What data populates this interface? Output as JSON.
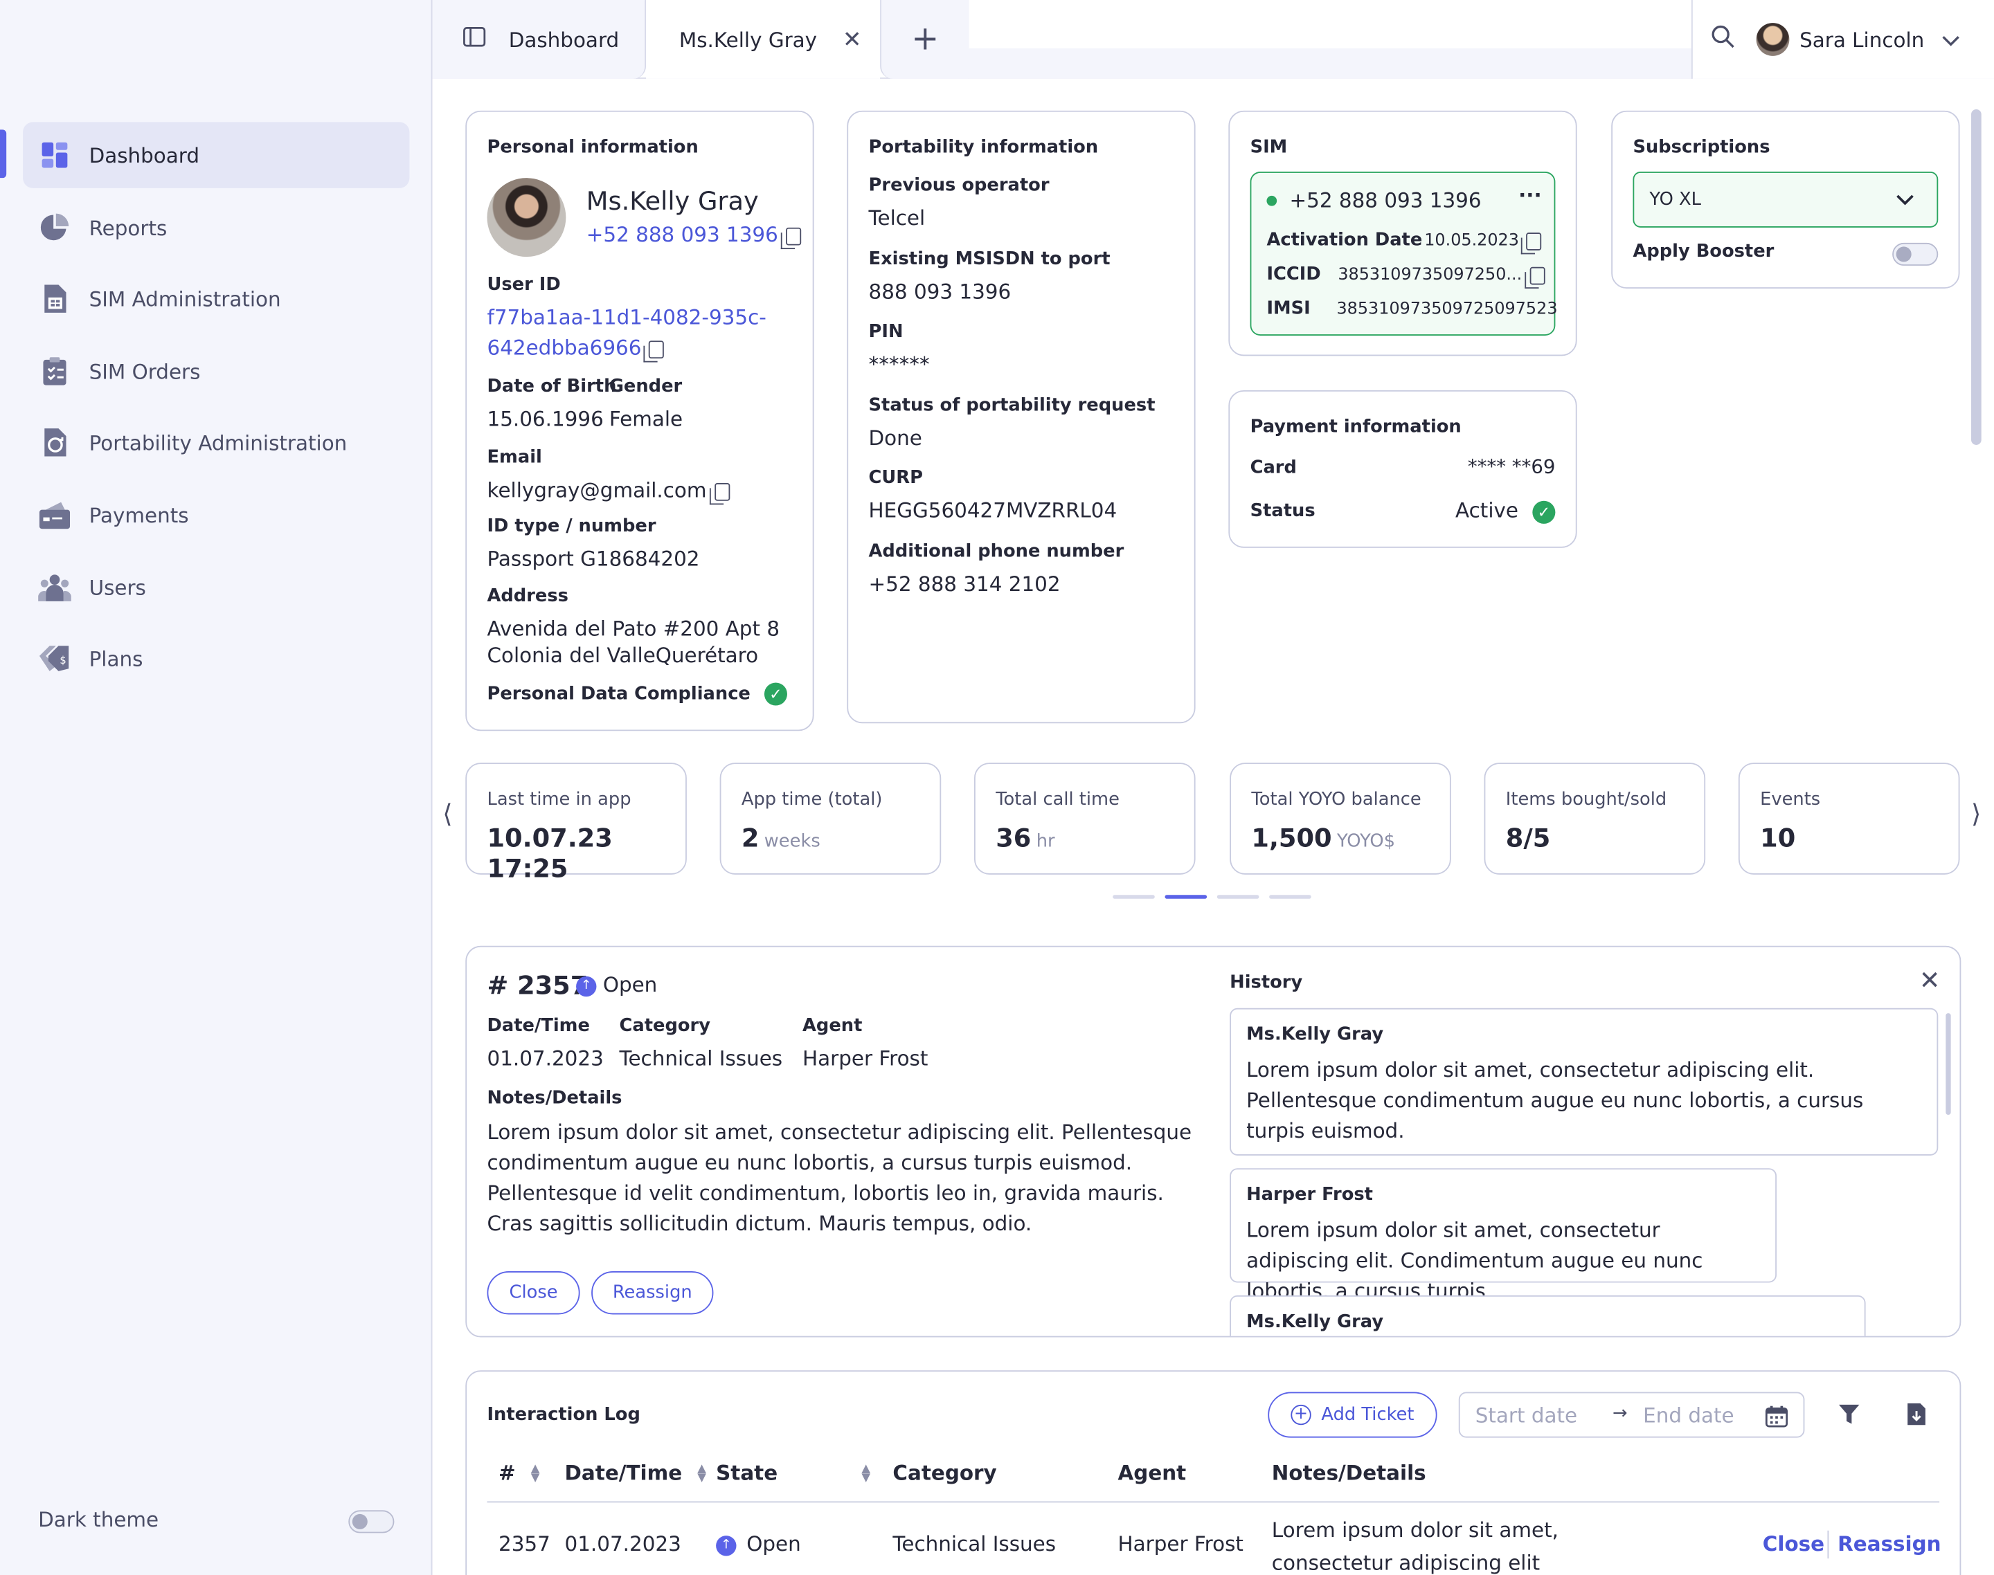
{
  "sidebar": {
    "items": [
      {
        "label": "Dashboard",
        "icon": "dashboard-icon"
      },
      {
        "label": "Reports",
        "icon": "pie-chart-icon"
      },
      {
        "label": "SIM Administration",
        "icon": "sim-card-icon"
      },
      {
        "label": "SIM Orders",
        "icon": "clipboard-icon"
      },
      {
        "label": "Portability Administration",
        "icon": "portability-icon"
      },
      {
        "label": "Payments",
        "icon": "wallet-icon"
      },
      {
        "label": "Users",
        "icon": "users-icon"
      },
      {
        "label": "Plans",
        "icon": "price-tag-icon"
      }
    ],
    "dark_theme_label": "Dark theme",
    "dark_theme_on": false
  },
  "topbar": {
    "tab_dashboard": "Dashboard",
    "tab_customer": "Ms.Kelly Gray",
    "user_name": "Sara Lincoln"
  },
  "personal": {
    "title": "Personal information",
    "name": "Ms.Kelly Gray",
    "phone": "+52 888 093 1396",
    "user_id_label": "User ID",
    "user_id_line1": "f77ba1aa-11d1-4082-935c-",
    "user_id_line2": "642edbba6966",
    "dob_label": "Date of Birth",
    "dob": "15.06.1996",
    "gender_label": "Gender",
    "gender": "Female",
    "email_label": "Email",
    "email": "kellygray@gmail.com",
    "id_label": "ID type / number",
    "id_value": "Passport G18684202",
    "address_label": "Address",
    "address_line1": "Avenida del Pato #200 Apt 8",
    "address_line2": "Colonia del ValleQuerétaro",
    "compliance": "Personal Data Compliance"
  },
  "portability": {
    "title": "Portability information",
    "prev_operator_label": "Previous operator",
    "prev_operator": "Telcel",
    "msisdn_label": "Existing MSISDN to port",
    "msisdn": "888 093 1396",
    "pin_label": "PIN",
    "pin": "******",
    "status_label": "Status of portability request",
    "status": "Done",
    "curp_label": "CURP",
    "curp": "HEGG560427MVZRRL04",
    "additional_label": "Additional phone number",
    "additional": "+52 888 314 2102"
  },
  "sim": {
    "title": "SIM",
    "number": "+52 888 093 1396",
    "activation_label": "Activation Date",
    "activation": "10.05.2023",
    "iccid_label": "ICCID",
    "iccid": "3853109735097250...",
    "imsi_label": "IMSI",
    "imsi": "385310973509725097523",
    "status_color": "#2ba560"
  },
  "payment": {
    "title": "Payment information",
    "card_label": "Card",
    "card": "**** **69",
    "status_label": "Status",
    "status": "Active"
  },
  "subscriptions": {
    "title": "Subscriptions",
    "plan": "YO XL",
    "booster_label": "Apply Booster",
    "booster_on": false
  },
  "stats": [
    {
      "label": "Last time in app",
      "value": "10.07.23 17:25",
      "unit": ""
    },
    {
      "label": "App time  (total)",
      "value": "2",
      "unit": "weeks"
    },
    {
      "label": "Total call time",
      "value": "36",
      "unit": "hr"
    },
    {
      "label": "Total YOYO balance",
      "value": "1,500",
      "unit": "YOYO$"
    },
    {
      "label": "Items bought/sold",
      "value": "8/5",
      "unit": ""
    },
    {
      "label": "Events",
      "value": "10",
      "unit": ""
    }
  ],
  "stats_page": {
    "current": 2,
    "total": 4
  },
  "ticket": {
    "number": "# 2357",
    "state": "Open",
    "date_label": "Date/Time",
    "date": "01.07.2023",
    "category_label": "Category",
    "category": "Technical Issues",
    "agent_label": "Agent",
    "agent": "Harper Frost",
    "notes_label": "Notes/Details",
    "notes": "Lorem ipsum dolor sit amet, consectetur adipiscing elit. Pellentesque condimentum augue eu nunc lobortis, a cursus turpis euismod. Pellentesque id velit condimentum, lobortis leo in, gravida mauris. Cras sagittis sollicitudin dictum. Mauris tempus, odio.",
    "close_label": "Close",
    "reassign_label": "Reassign",
    "history_title": "History",
    "history": [
      {
        "name": "Ms.Kelly Gray",
        "text": "Lorem ipsum dolor sit amet, consectetur adipiscing elit. Pellentesque condimentum augue eu nunc lobortis, a cursus turpis euismod."
      },
      {
        "name": "Harper Frost",
        "text": "Lorem ipsum dolor sit amet, consectetur adipiscing elit. Condimentum augue eu nunc lobortis, a cursus turpis"
      },
      {
        "name": "Ms.Kelly Gray",
        "text": ""
      }
    ]
  },
  "log": {
    "title": "Interaction Log",
    "add_ticket": "Add Ticket",
    "start_placeholder": "Start date",
    "end_placeholder": "End date",
    "columns": [
      "#",
      "Date/Time",
      "State",
      "Category",
      "Agent",
      "Notes/Details"
    ],
    "rows": [
      {
        "id": "2357",
        "date": "01.07.2023",
        "state": "Open",
        "category": "Technical Issues",
        "agent": "Harper Frost",
        "notes": "Lorem ipsum dolor sit amet, consectetur adipiscing elit",
        "action_close": "Close",
        "action_reassign": "Reassign"
      }
    ]
  },
  "colors": {
    "accent": "#5b63e8",
    "success": "#2ba560",
    "border": "#c9cce0"
  }
}
